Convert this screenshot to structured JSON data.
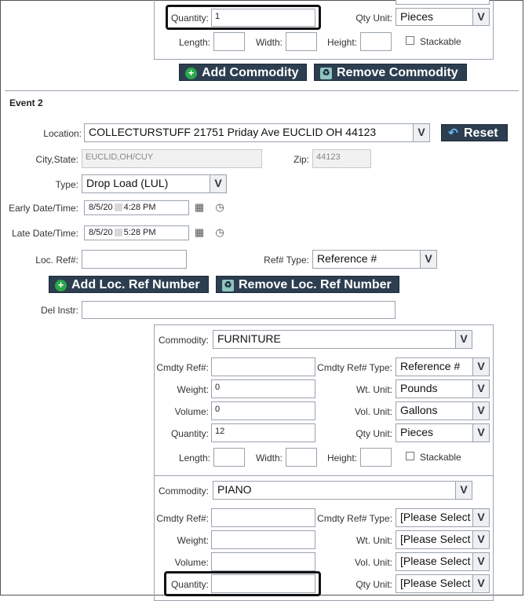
{
  "event1": {
    "quantity_label": "Quantity:",
    "quantity_value": "1",
    "qty_unit_label": "Qty Unit:",
    "qty_unit_value": "Pieces",
    "length_label": "Length:",
    "width_label": "Width:",
    "height_label": "Height:",
    "stackable_label": "Stackable",
    "add_commodity": "Add Commodity",
    "remove_commodity": "Remove Commodity"
  },
  "event2": {
    "heading": "Event 2",
    "location_label": "Location:",
    "location_value": "COLLECTURSTUFF 21751 Priday Ave EUCLID OH 44123",
    "reset_label": "Reset",
    "city_state_label": "City,State:",
    "city_state_value": "EUCLID,OH/CUY",
    "zip_label": "Zip:",
    "zip_value": "44123",
    "type_label": "Type:",
    "type_value": "Drop Load (LUL)",
    "early_label": "Early Date/Time:",
    "early_date": "8/5/20",
    "early_time": "4:28 PM",
    "late_label": "Late Date/Time:",
    "late_date": "8/5/20",
    "late_time": "5:28 PM",
    "loc_ref_label": "Loc. Ref#:",
    "ref_type_label": "Ref# Type:",
    "ref_type_value": "Reference #",
    "add_loc_ref": "Add Loc. Ref Number",
    "remove_loc_ref": "Remove Loc. Ref Number",
    "del_instr_label": "Del Instr:"
  },
  "commodity_a": {
    "commodity_label": "Commodity:",
    "commodity_value": "FURNITURE",
    "cmdty_ref_label": "Cmdty Ref#:",
    "cmdty_ref_type_label": "Cmdty Ref# Type:",
    "cmdty_ref_type_value": "Reference #",
    "weight_label": "Weight:",
    "weight_value": "0",
    "wt_unit_label": "Wt. Unit:",
    "wt_unit_value": "Pounds",
    "volume_label": "Volume:",
    "volume_value": "0",
    "vol_unit_label": "Vol. Unit:",
    "vol_unit_value": "Gallons",
    "quantity_label": "Quantity:",
    "quantity_value": "12",
    "qty_unit_label": "Qty Unit:",
    "qty_unit_value": "Pieces",
    "length_label": "Length:",
    "width_label": "Width:",
    "height_label": "Height:",
    "stackable_label": "Stackable"
  },
  "commodity_b": {
    "commodity_label": "Commodity:",
    "commodity_value": "PIANO",
    "cmdty_ref_label": "Cmdty Ref#:",
    "cmdty_ref_type_label": "Cmdty Ref# Type:",
    "cmdty_ref_type_value": "[Please Select",
    "weight_label": "Weight:",
    "wt_unit_label": "Wt. Unit:",
    "wt_unit_value": "[Please Select",
    "volume_label": "Volume:",
    "vol_unit_label": "Vol. Unit:",
    "vol_unit_value": "[Please Select",
    "quantity_label": "Quantity:",
    "qty_unit_label": "Qty Unit:",
    "qty_unit_value": "[Please Select"
  }
}
